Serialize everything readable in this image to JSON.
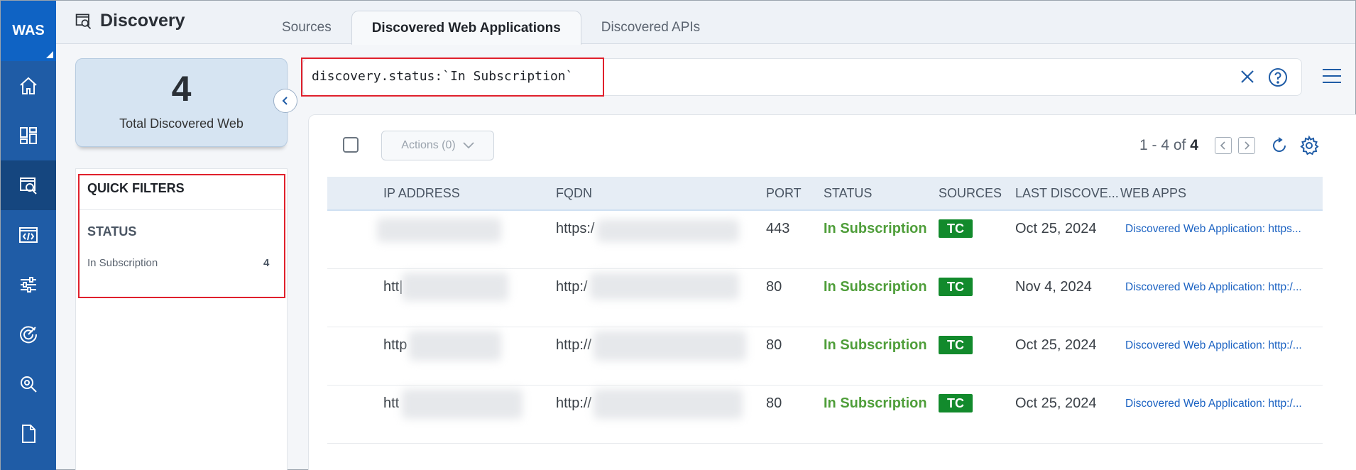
{
  "nav": {
    "brand": "WAS",
    "items": [
      {
        "icon": "home-icon"
      },
      {
        "icon": "dashboard-icon"
      },
      {
        "icon": "discovery-icon",
        "active": true
      },
      {
        "icon": "web-app-icon"
      },
      {
        "icon": "sliders-icon"
      },
      {
        "icon": "radar-icon"
      },
      {
        "icon": "search-bug-icon"
      },
      {
        "icon": "document-icon"
      }
    ]
  },
  "header": {
    "title": "Discovery",
    "tabs": [
      {
        "label": "Sources",
        "active": false
      },
      {
        "label": "Discovered Web Applications",
        "active": true
      },
      {
        "label": "Discovered APIs",
        "active": false
      }
    ]
  },
  "summary": {
    "count": "4",
    "label": "Total Discovered Web"
  },
  "quick_filters": {
    "title": "QUICK FILTERS",
    "group": "STATUS",
    "items": [
      {
        "label": "In Subscription",
        "count": "4"
      }
    ]
  },
  "search": {
    "query": "discovery.status:`In Subscription`"
  },
  "toolbar": {
    "actions_label": "Actions (0)",
    "range": "1 - 4 of ",
    "total": "4"
  },
  "table": {
    "columns": [
      "IP ADDRESS",
      "FQDN",
      "PORT",
      "STATUS",
      "SOURCES",
      "LAST DISCOVE...",
      "WEB APPS"
    ],
    "rows": [
      {
        "ip": "",
        "fqdn": "https:/",
        "port": "443",
        "status": "In Subscription",
        "source": "TC",
        "last": "Oct 25, 2024",
        "webapp": "Discovered Web Application: https..."
      },
      {
        "ip": "htt|",
        "fqdn": "http:/",
        "port": "80",
        "status": "In Subscription",
        "source": "TC",
        "last": "Nov 4, 2024",
        "webapp": "Discovered Web Application: http:/..."
      },
      {
        "ip": "http",
        "fqdn": "http://",
        "port": "80",
        "status": "In Subscription",
        "source": "TC",
        "last": "Oct 25, 2024",
        "webapp": "Discovered Web Application: http:/..."
      },
      {
        "ip": "htt",
        "fqdn": "http://",
        "port": "80",
        "status": "In Subscription",
        "source": "TC",
        "last": "Oct 25, 2024",
        "webapp": "Discovered Web Application: http:/..."
      }
    ]
  },
  "colors": {
    "nav_bg": "#1f5ca6",
    "brand_bg": "#0f63c4",
    "status_green": "#4f9e3a",
    "badge_green": "#128a2c",
    "highlight_red": "#e0202c",
    "link_blue": "#1b62c2"
  }
}
